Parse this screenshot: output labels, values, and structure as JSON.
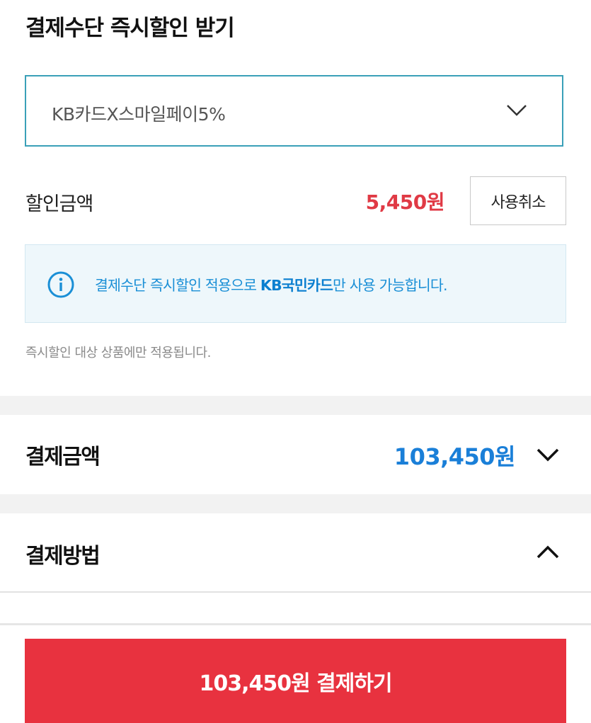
{
  "instant_discount": {
    "title": "결제수단 즉시할인 받기",
    "selected_option": "KB카드X스마일페이5%",
    "discount_label": "할인금액",
    "discount_amount": "5,450원",
    "cancel_label": "사용취소",
    "info_prefix": "결제수단 즉시할인 적용으로 ",
    "info_card": "KB국민카드",
    "info_suffix": "만 사용 가능합니다.",
    "note": "즉시할인 대상 상품에만 적용됩니다."
  },
  "payment_amount": {
    "label": "결제금액",
    "amount": "103,450원"
  },
  "payment_method": {
    "label": "결제방법"
  },
  "pay_button": {
    "label": "103,450원 결제하기"
  },
  "colors": {
    "accent_red": "#e8323f",
    "discount_red": "#e03a45",
    "amount_blue": "#1a7fd8",
    "info_blue": "#1a8fd6",
    "select_border": "#3aa0b8"
  }
}
